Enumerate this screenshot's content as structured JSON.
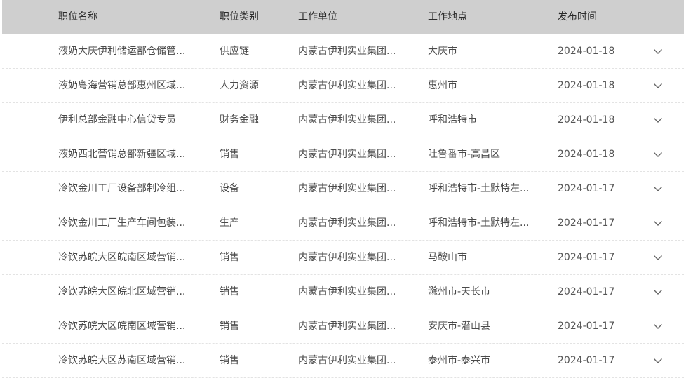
{
  "header": {
    "title": "职位名称",
    "category": "职位类别",
    "org": "工作单位",
    "location": "工作地点",
    "date": "发布时间"
  },
  "rows": [
    {
      "title": "液奶大庆伊利储运部仓储管...",
      "category": "供应链",
      "org": "内蒙古伊利实业集团...",
      "location": "大庆市",
      "date": "2024-01-18"
    },
    {
      "title": "液奶粤海营销总部惠州区域...",
      "category": "人力资源",
      "org": "内蒙古伊利实业集团...",
      "location": "惠州市",
      "date": "2024-01-18"
    },
    {
      "title": "伊利总部金融中心信贷专员",
      "category": "财务金融",
      "org": "内蒙古伊利实业集团...",
      "location": "呼和浩特市",
      "date": "2024-01-18"
    },
    {
      "title": "液奶西北营销总部新疆区域...",
      "category": "销售",
      "org": "内蒙古伊利实业集团...",
      "location": "吐鲁番市-高昌区",
      "date": "2024-01-18"
    },
    {
      "title": "冷饮金川工厂设备部制冷组...",
      "category": "设备",
      "org": "内蒙古伊利实业集团...",
      "location": "呼和浩特市-土默特左...",
      "date": "2024-01-17"
    },
    {
      "title": "冷饮金川工厂生产车间包装...",
      "category": "生产",
      "org": "内蒙古伊利实业集团...",
      "location": "呼和浩特市-土默特左...",
      "date": "2024-01-17"
    },
    {
      "title": "冷饮苏皖大区皖南区域营销...",
      "category": "销售",
      "org": "内蒙古伊利实业集团...",
      "location": "马鞍山市",
      "date": "2024-01-17"
    },
    {
      "title": "冷饮苏皖大区皖北区域营销...",
      "category": "销售",
      "org": "内蒙古伊利实业集团...",
      "location": "滁州市-天长市",
      "date": "2024-01-17"
    },
    {
      "title": "冷饮苏皖大区皖南区域营销...",
      "category": "销售",
      "org": "内蒙古伊利实业集团...",
      "location": "安庆市-潜山县",
      "date": "2024-01-17"
    },
    {
      "title": "冷饮苏皖大区苏南区域营销...",
      "category": "销售",
      "org": "内蒙古伊利实业集团...",
      "location": "泰州市-泰兴市",
      "date": "2024-01-17"
    }
  ],
  "icons": {
    "expand": "chevron-down-icon"
  },
  "colors": {
    "header_bg": "#cfcfcf",
    "text": "#4a4a4a",
    "divider": "#e3e3e3"
  }
}
